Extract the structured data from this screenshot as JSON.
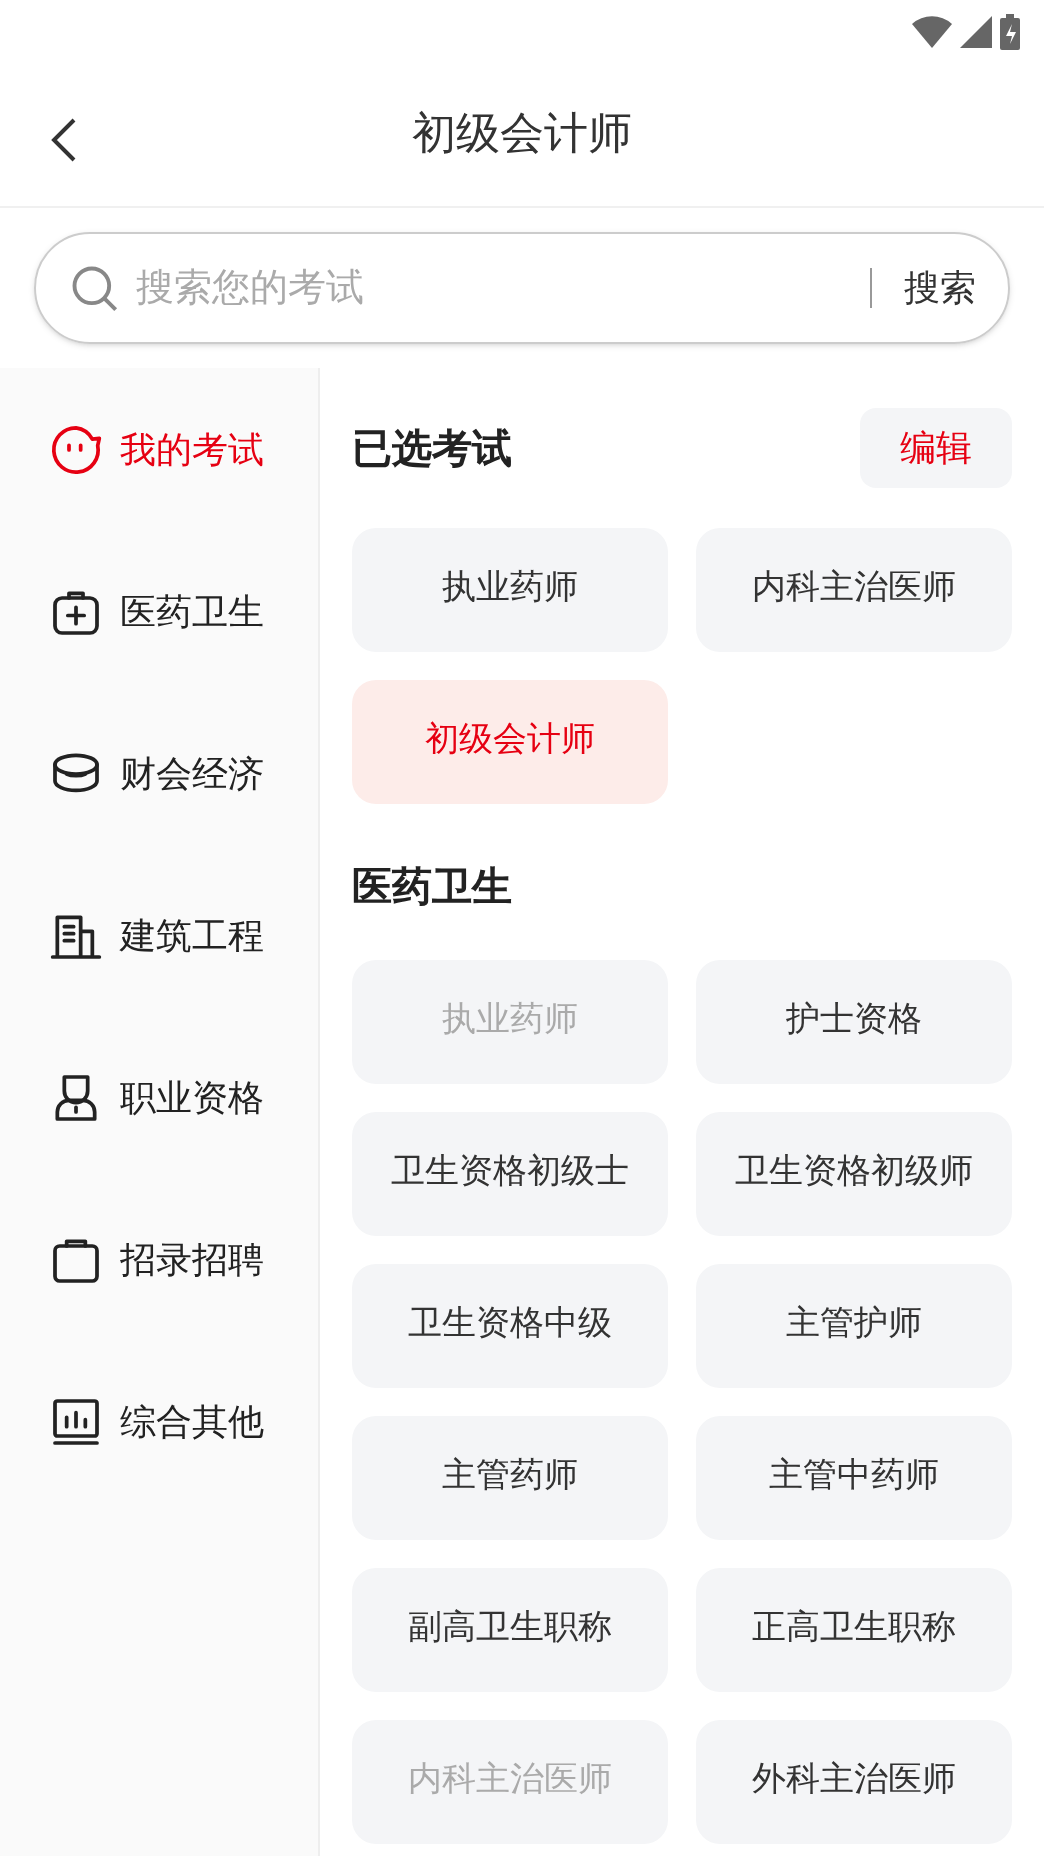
{
  "header": {
    "title": "初级会计师"
  },
  "search": {
    "placeholder": "搜索您的考试",
    "button": "搜索"
  },
  "sidebar": {
    "items": [
      {
        "label": "我的考试",
        "kind": "face",
        "selected": true
      },
      {
        "label": "医药卫生",
        "kind": "medkit",
        "selected": false
      },
      {
        "label": "财会经济",
        "kind": "coins",
        "selected": false
      },
      {
        "label": "建筑工程",
        "kind": "building",
        "selected": false
      },
      {
        "label": "职业资格",
        "kind": "worker",
        "selected": false
      },
      {
        "label": "招录招聘",
        "kind": "briefcase",
        "selected": false
      },
      {
        "label": "综合其他",
        "kind": "chart",
        "selected": false
      }
    ]
  },
  "selected_section": {
    "title": "已选考试",
    "edit_button": "编辑",
    "exams": [
      {
        "label": "执业药师",
        "selected": false
      },
      {
        "label": "内科主治医师",
        "selected": false
      },
      {
        "label": "初级会计师",
        "selected": true
      }
    ]
  },
  "category_section": {
    "title": "医药卫生",
    "exams": [
      {
        "label": "执业药师",
        "disabled": true
      },
      {
        "label": "护士资格",
        "disabled": false
      },
      {
        "label": "卫生资格初级士",
        "disabled": false
      },
      {
        "label": "卫生资格初级师",
        "disabled": false
      },
      {
        "label": "卫生资格中级",
        "disabled": false
      },
      {
        "label": "主管护师",
        "disabled": false
      },
      {
        "label": "主管药师",
        "disabled": false
      },
      {
        "label": "主管中药师",
        "disabled": false
      },
      {
        "label": "副高卫生职称",
        "disabled": false
      },
      {
        "label": "正高卫生职称",
        "disabled": false
      },
      {
        "label": "内科主治医师",
        "disabled": true
      },
      {
        "label": "外科主治医师",
        "disabled": false
      }
    ]
  }
}
